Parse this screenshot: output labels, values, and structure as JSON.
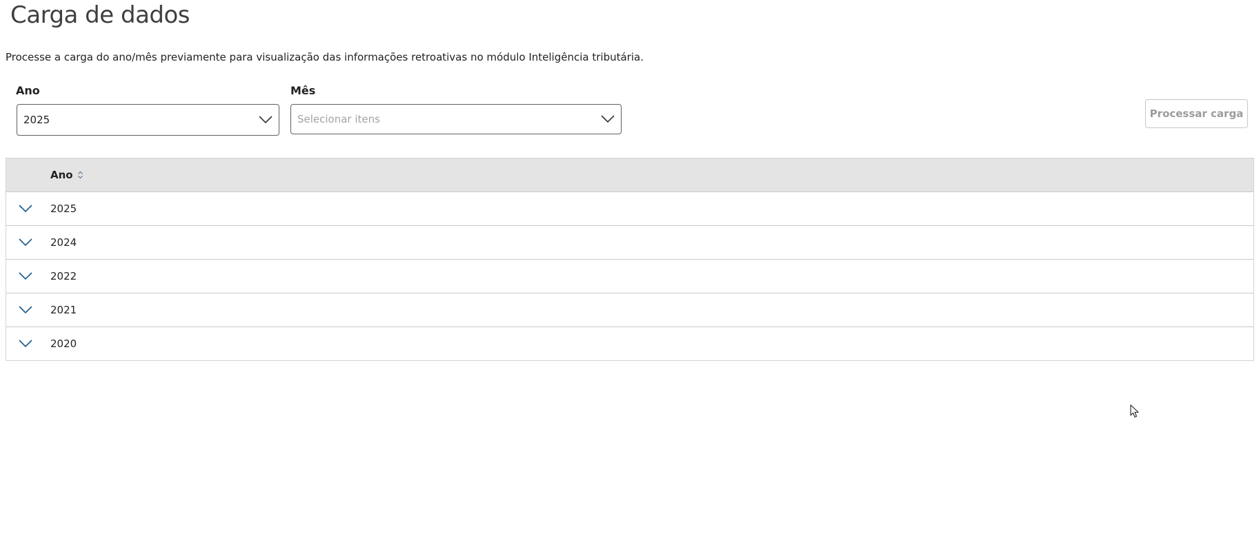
{
  "page": {
    "title": "Carga de dados",
    "description": "Processe a carga do ano/mês previamente para visualização das informações retroativas no módulo Inteligência tributária."
  },
  "filters": {
    "year": {
      "label": "Ano",
      "value": "2025",
      "icon": "chevron-down-icon"
    },
    "month": {
      "label": "Mês",
      "placeholder": "Selecionar itens",
      "icon": "chevron-down-icon"
    },
    "process_button": {
      "label": "Processar carga",
      "state": "disabled"
    }
  },
  "table": {
    "columns": [
      {
        "label": "Ano",
        "sortable": true,
        "icon": "sort-icon"
      }
    ],
    "rows": [
      {
        "ano": "2025",
        "icon": "chevron-down-icon"
      },
      {
        "ano": "2024",
        "icon": "chevron-down-icon"
      },
      {
        "ano": "2022",
        "icon": "chevron-down-icon"
      },
      {
        "ano": "2021",
        "icon": "chevron-down-icon"
      },
      {
        "ano": "2020",
        "icon": "chevron-down-icon"
      }
    ]
  },
  "colors": {
    "header_background": "#e4e4e4",
    "expand_icon": "#1a5a8a",
    "disabled_text": "#9c9c9c",
    "border": "#5f5f5f"
  }
}
